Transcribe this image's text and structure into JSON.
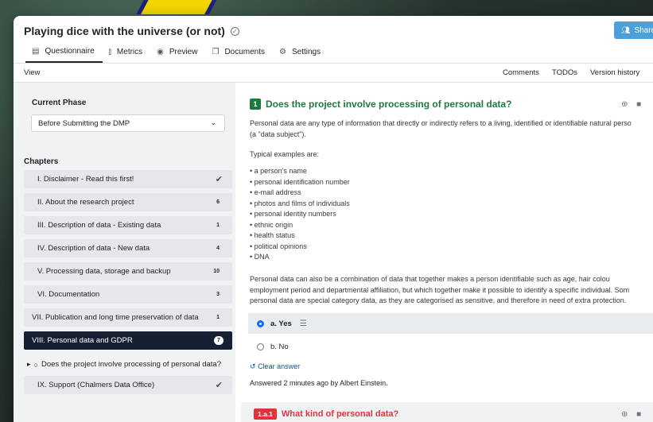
{
  "app": {
    "title": "Playing dice with the universe (or not)",
    "share_label": "Share"
  },
  "tabs": [
    {
      "label": "Questionnaire",
      "icon": "table-icon"
    },
    {
      "label": "Metrics",
      "icon": "bar-chart-icon"
    },
    {
      "label": "Preview",
      "icon": "eye-icon"
    },
    {
      "label": "Documents",
      "icon": "copy-icon"
    },
    {
      "label": "Settings",
      "icon": "gears-icon"
    }
  ],
  "viewbar": {
    "view_label": "View",
    "comments": "Comments",
    "todos": "TODOs",
    "version_history": "Version history"
  },
  "sidebar": {
    "phase_label": "Current Phase",
    "phase_value": "Before Submitting the DMP",
    "chapters_label": "Chapters",
    "chapters": [
      {
        "label": "I. Disclaimer - Read this first!",
        "badge": "✔"
      },
      {
        "label": "II. About the research project",
        "badge": "6"
      },
      {
        "label": "III. Description of data - Existing data",
        "badge": "1"
      },
      {
        "label": "IV. Description of data - New data",
        "badge": "4"
      },
      {
        "label": "V. Processing data, storage and backup",
        "badge": "10"
      },
      {
        "label": "VI. Documentation",
        "badge": "3"
      },
      {
        "label": "VII. Publication and long time preservation of data",
        "badge": "1"
      },
      {
        "label": "VIII. Personal data and GDPR",
        "badge": "7"
      },
      {
        "label": "IX. Support (Chalmers Data Office)",
        "badge": "✔"
      }
    ],
    "sub_item": "Does the project involve processing of personal data?"
  },
  "question": {
    "number": "1",
    "title": "Does the project involve processing of personal data?",
    "intro_1": "Personal data are any type of information that directly or indirectly refers to a living, identified or identifiable natural perso",
    "intro_2": "(a \"data subject\").",
    "typical": "Typical examples are:",
    "examples": [
      "a person's name",
      "personal identification number",
      "e-mail address",
      "photos and films of individuals",
      "personal identity numbers",
      "ethnic origin",
      "health status",
      "political opinions",
      "DNA"
    ],
    "para_1": "Personal data can also be a combination of data that together makes a person identifiable such as age, hair colou",
    "para_2": "employment period and departmental affiliation, but which together make it possible to identify a specific individual. Som",
    "para_3": "personal data are special category data, as they are categorised as sensitive, and therefore in need of extra protection.",
    "options": [
      {
        "label": "a. Yes",
        "selected": true
      },
      {
        "label": "b. No",
        "selected": false
      }
    ],
    "clear_label": "Clear answer",
    "answered": "Answered 2 minutes ago by Albert Einstein."
  },
  "subquestion": {
    "number": "1.a.1",
    "title": "What kind of personal data?"
  },
  "colors": {
    "accent_green": "#1d7a3d",
    "share_blue": "#4ba0d9",
    "active_chapter": "#172033",
    "subquestion_red": "#e0333a"
  }
}
